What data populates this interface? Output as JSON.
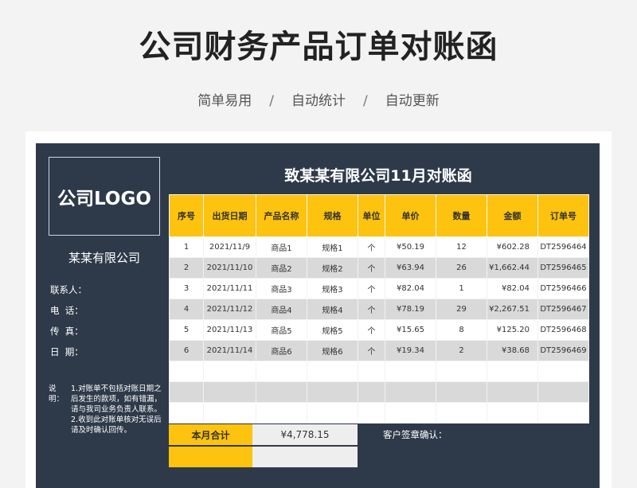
{
  "header": {
    "title": "公司财务产品订单对账函",
    "tags": [
      "简单易用",
      "自动统计",
      "自动更新"
    ],
    "separator": "/"
  },
  "left_panel": {
    "logo_text": "公司LOGO",
    "company_name": "某某有限公司",
    "contact_label": "联系人：",
    "phone_label": "电  话：",
    "fax_label": "传  真：",
    "date_label": "日  期：",
    "note_key": "说明：",
    "note_lines": [
      "1.对账单不包括对账日期之后发生的款项，如有错漏，请与我司业务负责人联系。",
      "2.收到此对账单核对无误后请及时确认回传。"
    ]
  },
  "statement": {
    "title": "致某某有限公司11月对账函",
    "columns": [
      "序号",
      "出货日期",
      "产品名称",
      "规格",
      "单位",
      "单价",
      "数量",
      "金额",
      "订单号"
    ],
    "rows": [
      {
        "no": "1",
        "date": "2021/11/9",
        "product": "商品1",
        "spec": "规格1",
        "unit": "个",
        "price": "¥50.19",
        "qty": "12",
        "amount": "¥602.28",
        "order": "DT2596464"
      },
      {
        "no": "2",
        "date": "2021/11/10",
        "product": "商品2",
        "spec": "规格2",
        "unit": "个",
        "price": "¥63.94",
        "qty": "26",
        "amount": "¥1,662.44",
        "order": "DT2596465"
      },
      {
        "no": "3",
        "date": "2021/11/11",
        "product": "商品3",
        "spec": "规格3",
        "unit": "个",
        "price": "¥82.04",
        "qty": "1",
        "amount": "¥82.04",
        "order": "DT2596466"
      },
      {
        "no": "4",
        "date": "2021/11/12",
        "product": "商品4",
        "spec": "规格4",
        "unit": "个",
        "price": "¥78.19",
        "qty": "29",
        "amount": "¥2,267.51",
        "order": "DT2596467"
      },
      {
        "no": "5",
        "date": "2021/11/13",
        "product": "商品5",
        "spec": "规格5",
        "unit": "个",
        "price": "¥15.65",
        "qty": "8",
        "amount": "¥125.20",
        "order": "DT2596468"
      },
      {
        "no": "6",
        "date": "2021/11/14",
        "product": "商品6",
        "spec": "规格6",
        "unit": "个",
        "price": "¥19.34",
        "qty": "2",
        "amount": "¥38.68",
        "order": "DT2596469"
      }
    ],
    "total_label": "本月合计",
    "total_value": "¥4,778.15",
    "sign_label": "客户签章确认："
  }
}
